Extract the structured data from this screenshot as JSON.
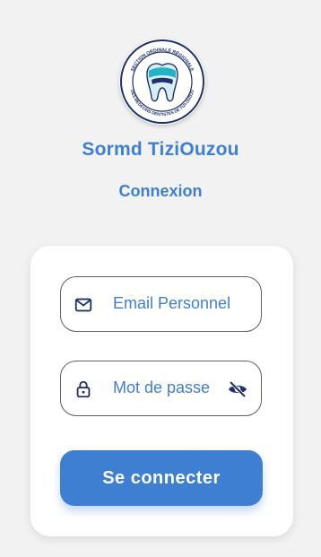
{
  "logo": {
    "ring_text_top": "SECTION ORDINALE RÉGIONALE",
    "ring_text_bottom": "DES MEDECINS DENTISTES DE TIZI-OUZOU",
    "colors": {
      "navy": "#20306b",
      "teal": "#23b3c7",
      "light": "#d6eef4"
    }
  },
  "header": {
    "title": "Sormd TiziOuzou",
    "subtitle": "Connexion"
  },
  "form": {
    "email": {
      "icon": "mail-icon",
      "text": "Email Personnel"
    },
    "password": {
      "icon": "lock-icon",
      "text": "Mot de passe",
      "toggle_icon": "eye-off-icon"
    },
    "submit_label": "Se connecter"
  },
  "colors": {
    "accent": "#3f7fd1",
    "background": "#f2f2f2",
    "card": "#ffffff",
    "border": "#5f5f5f"
  }
}
